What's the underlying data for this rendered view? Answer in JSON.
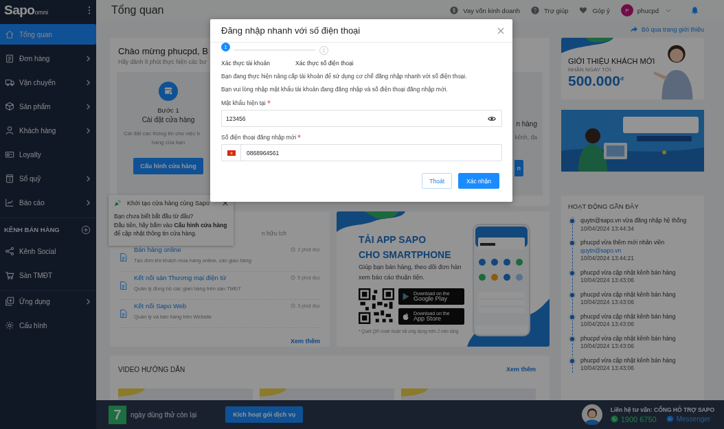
{
  "sidebar": {
    "logo": "Sapo",
    "logo_suffix": "omni",
    "items": [
      {
        "label": "Tổng quan",
        "submenu": false,
        "selected": true
      },
      {
        "label": "Đơn hàng",
        "submenu": true,
        "selected": false
      },
      {
        "label": "Vận chuyển",
        "submenu": true,
        "selected": false
      },
      {
        "label": "Sản phẩm",
        "submenu": true,
        "selected": false
      },
      {
        "label": "Khách hàng",
        "submenu": true,
        "selected": false
      },
      {
        "label": "Loyalty",
        "submenu": false,
        "selected": false
      },
      {
        "label": "Sổ quỹ",
        "submenu": true,
        "selected": false
      },
      {
        "label": "Báo cáo",
        "submenu": true,
        "selected": false
      }
    ],
    "section_title": "KÊNH BÁN HÀNG",
    "section_items": [
      {
        "label": "Kênh Social",
        "submenu": false,
        "selected": false
      },
      {
        "label": "Sàn TMĐT",
        "submenu": false,
        "selected": false
      }
    ],
    "footer_items": [
      {
        "label": "Ứng dụng",
        "submenu": true,
        "selected": false
      },
      {
        "label": "Cấu hình",
        "submenu": false,
        "selected": false
      }
    ]
  },
  "header": {
    "title": "Tổng quan",
    "links": [
      "Vay vốn kinh doanh",
      "Trợ giúp",
      "Góp ý"
    ],
    "user": {
      "initial": "P",
      "name": "phucpd"
    }
  },
  "welcome": {
    "title": "Chào mừng phucpd, B",
    "subtitle": "Hãy dành ít phút thực hiện các bư",
    "step": {
      "label": "Bước 1",
      "title": "Cài đặt cửa hàng",
      "description_lines": [
        "Cài đặt các thông tin cho việc b",
        "hàng của bạn"
      ],
      "button": "Cấu hình cửa hàng"
    },
    "next_step": {
      "title_fragment": "n hàng",
      "description_fragment": "kênh, đa",
      "button_fragment": "n"
    }
  },
  "popover": {
    "title": "Khởi tạo cửa hàng cùng Sapo",
    "lines": [
      "Bạn chưa biết bắt đầu từ đâu?",
      "Đầu tiên, hãy bấm vào **Cấu hình cửa hàng** để cập nhật thông tin cửa hàng."
    ]
  },
  "guides": {
    "heading_fragment": "n hữu ích",
    "articles": [
      {
        "title": "Bán hàng online",
        "read_time": "2 phút đọc",
        "description": "Tạo đơn khi khách mua hàng online, cần giao hàng"
      },
      {
        "title": "Kết nối sàn Thương mại điện tử",
        "read_time": "5 phút đọc",
        "description": "Quản lý đồng bộ các gian hàng trên sàn TMĐT"
      },
      {
        "title": "Kết nối Sapo Web",
        "read_time": "3 phút đọc",
        "description": "Quản lý và bán hàng trên Website"
      }
    ],
    "more": "Xem thêm"
  },
  "app_banner": {
    "title_lines": [
      "TẢI APP SAPO",
      "CHO SMARTPHONE"
    ],
    "description_lines": [
      "Giúp bạn bán hàng, theo dõi đơn hàn",
      "xem báo cáo thuận tiện."
    ],
    "stores": [
      {
        "caption": "Download on the",
        "name": "Google Play"
      },
      {
        "caption": "Download on the",
        "name": "App Store"
      }
    ],
    "note": "* Quét QR code hoặc tải ứng dụng trên 2 nền tảng"
  },
  "videos": {
    "title": "VIDEO HƯỚNG DẪN",
    "more": "Xem thêm"
  },
  "skip_link": "Bỏ qua trang giới thiệu",
  "promo": {
    "headline": "GIỚI THIỆU KHÁCH MỚI",
    "subline": "NHẬN NGAY TỚI",
    "amount": "500.000",
    "currency": "đ"
  },
  "activity": {
    "title": "HOẠT ĐỘNG GẦN ĐÂY",
    "items": [
      {
        "text": "quytn@sapo.vn vừa đăng nhập hệ thống",
        "time": "10/04/2024 13:44:34"
      },
      {
        "text": "phucpd vừa thêm mới nhân viên",
        "link": "quytn@sapo.vn",
        "time": "10/04/2024 13:44:21"
      },
      {
        "text": "phucpd vừa cập nhật kênh bán hàng",
        "time": "10/04/2024 13:43:06"
      },
      {
        "text": "phucpd vừa cập nhật kênh bán hàng",
        "time": "10/04/2024 13:43:06"
      },
      {
        "text": "phucpd vừa cập nhật kênh bán hàng",
        "time": "10/04/2024 13:43:06"
      },
      {
        "text": "phucpd vừa cập nhật kênh bán hàng",
        "time": "10/04/2024 13:43:06"
      },
      {
        "text": "phucpd vừa cập nhật kênh bán hàng",
        "time": "10/04/2024 13:43:06"
      }
    ]
  },
  "bottom_bar": {
    "trial_days": "7",
    "trial_text": "ngày dùng thử còn lại",
    "button": "Kích hoạt gói dịch vụ",
    "contact": "Liên hệ tư vấn: CỔNG HỖ TRỢ SAPO",
    "phone": "1900 6750",
    "messenger": "Messenger"
  },
  "modal": {
    "title": "Đăng nhập nhanh với số điện thoại",
    "steps": [
      {
        "number": "1",
        "label": "Xác thực tài khoản",
        "selected": true
      },
      {
        "number": "2",
        "label": "Xác thực số điện thoại",
        "selected": false
      }
    ],
    "paragraphs": [
      "Bạn đang thực hiện nâng cấp tài khoản để sử dụng cơ chế đăng nhập nhanh với số điện thoại.",
      "Bạn vui lòng nhập mật khẩu tài khoản đang đăng nhập và số điện thoại đăng nhập mới."
    ],
    "fields": [
      {
        "kind": "password",
        "label": "Mật khẩu hiện tại",
        "required": true,
        "value": "123456"
      },
      {
        "kind": "phone",
        "label": "Số điện thoại đăng nhập mới",
        "required": true,
        "value": "0868964561"
      }
    ],
    "buttons": [
      {
        "label": "Thoát",
        "kind": "secondary"
      },
      {
        "label": "Xác nhận",
        "kind": "primary"
      }
    ]
  }
}
